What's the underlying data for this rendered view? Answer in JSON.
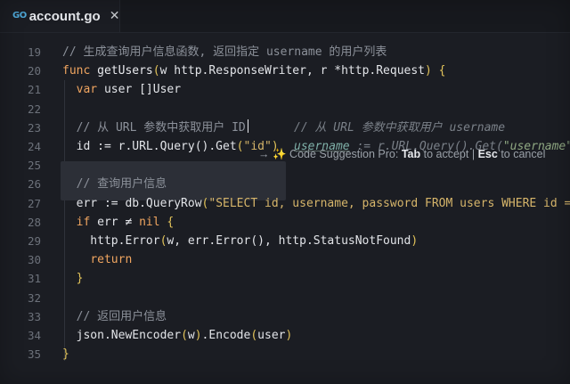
{
  "tab": {
    "icon": "go-file-icon",
    "icon_text": "GO",
    "title": "account.go",
    "close_symbol": "✕"
  },
  "suggestion": {
    "arrow": "→",
    "sparkle": "✨",
    "prefix": "Code Suggestion Pro:",
    "accept_key": "Tab",
    "accept_text": "to accept",
    "separator": "|",
    "cancel_key": "Esc",
    "cancel_text": "to cancel"
  },
  "lines": [
    {
      "num": "19",
      "segments": [
        {
          "c": "cm",
          "t": "// 生成查询用户信息函数, 返回指定 username 的用户列表"
        }
      ]
    },
    {
      "num": "20",
      "segments": [
        {
          "c": "kw",
          "t": "func "
        },
        {
          "c": "fn",
          "t": "getUsers"
        },
        {
          "c": "br",
          "t": "("
        },
        {
          "c": "pun",
          "t": "w http.ResponseWriter, r *http.Request"
        },
        {
          "c": "br",
          "t": ")"
        },
        {
          "c": "pun",
          "t": " "
        },
        {
          "c": "br",
          "t": "{"
        }
      ]
    },
    {
      "num": "21",
      "segments": [
        {
          "c": "pun",
          "t": "  "
        },
        {
          "c": "kw",
          "t": "var "
        },
        {
          "c": "pun",
          "t": "user []User"
        }
      ]
    },
    {
      "num": "22",
      "segments": []
    },
    {
      "num": "23",
      "segments": [
        {
          "c": "pun",
          "t": "  "
        },
        {
          "c": "cm",
          "t": "// 从 URL 参数中获取用户 ID"
        }
      ],
      "cursor": true,
      "ghost": "// 从 URL 参数中获取用户 username"
    },
    {
      "num": "24",
      "segments": [
        {
          "c": "pun",
          "t": "  id := r.URL.Query().Get"
        },
        {
          "c": "br",
          "t": "("
        },
        {
          "c": "str",
          "t": "\"id\""
        },
        {
          "c": "br",
          "t": ")"
        }
      ],
      "ghost_code": true
    },
    {
      "num": "25",
      "segments": []
    },
    {
      "num": "26",
      "segments": [
        {
          "c": "pun",
          "t": "  "
        },
        {
          "c": "cm",
          "t": "// 查询用户信息"
        }
      ]
    },
    {
      "num": "27",
      "segments": [
        {
          "c": "pun",
          "t": "  err := db.QueryRow"
        },
        {
          "c": "br",
          "t": "("
        },
        {
          "c": "str",
          "t": "\"SELECT id, username, password FROM users WHERE id = "
        }
      ]
    },
    {
      "num": "28",
      "segments": [
        {
          "c": "pun",
          "t": "  "
        },
        {
          "c": "kw",
          "t": "if "
        },
        {
          "c": "pun",
          "t": "err ≠ "
        },
        {
          "c": "kw",
          "t": "nil "
        },
        {
          "c": "br",
          "t": "{"
        }
      ]
    },
    {
      "num": "29",
      "segments": [
        {
          "c": "pun",
          "t": "    http.Error"
        },
        {
          "c": "br",
          "t": "("
        },
        {
          "c": "pun",
          "t": "w, err.Error(), http.StatusNotFound"
        },
        {
          "c": "br",
          "t": ")"
        }
      ]
    },
    {
      "num": "30",
      "segments": [
        {
          "c": "pun",
          "t": "    "
        },
        {
          "c": "kw",
          "t": "return"
        }
      ]
    },
    {
      "num": "31",
      "segments": [
        {
          "c": "pun",
          "t": "  "
        },
        {
          "c": "br",
          "t": "}"
        }
      ]
    },
    {
      "num": "32",
      "segments": []
    },
    {
      "num": "33",
      "segments": [
        {
          "c": "pun",
          "t": "  "
        },
        {
          "c": "cm",
          "t": "// 返回用户信息"
        }
      ]
    },
    {
      "num": "34",
      "segments": [
        {
          "c": "pun",
          "t": "  json.NewEncoder"
        },
        {
          "c": "br",
          "t": "("
        },
        {
          "c": "pun",
          "t": "w"
        },
        {
          "c": "br",
          "t": ")"
        },
        {
          "c": "pun",
          "t": ".Encode"
        },
        {
          "c": "br",
          "t": "("
        },
        {
          "c": "pun",
          "t": "user"
        },
        {
          "c": "br",
          "t": ")"
        }
      ]
    },
    {
      "num": "35",
      "segments": [
        {
          "c": "br",
          "t": "}"
        }
      ]
    }
  ],
  "ghost_line_24": {
    "var": "username",
    "middle": " := r.URL.Query().Get(",
    "arg": "\"username\"",
    "tail": ")"
  }
}
